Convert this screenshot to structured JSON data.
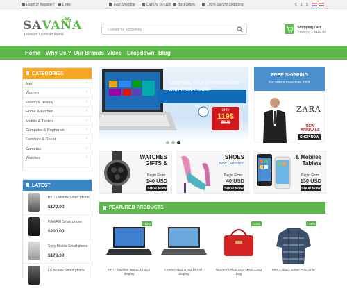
{
  "topbar": {
    "login": "Login",
    "or": "or",
    "register": "Register?",
    "links": "Links",
    "fast_shipping": "Fast Shipping",
    "call_us": "Call Us: 001125",
    "best_offers": "Best Offers",
    "secure_shopping": "100% Secure Shopping",
    "currencies": [
      "€",
      "£",
      "$"
    ]
  },
  "logo": {
    "name_part1": "SA",
    "name_part2": "VANA",
    "tagline": "premium Opencart theme"
  },
  "search": {
    "placeholder": "Looking for something ?"
  },
  "cart": {
    "title": "Shopping Cart",
    "summary": "3 item(s) - $445.00"
  },
  "nav": [
    "Home",
    "Why Us ?",
    "Our Brands",
    "Video",
    "Dropdown",
    "Blog"
  ],
  "categories": {
    "title": "CATEGORIES",
    "items": [
      "Men",
      "Women",
      "Health & Beauty",
      "Home & Kitchen",
      "Mobile & Tablets",
      "Computer & Prigherals",
      "Furniture & Decor",
      "Cameras",
      "Watches"
    ]
  },
  "latest": {
    "title": "LATEST",
    "items": [
      {
        "name": "HTCS Mobile Smart phone",
        "price": "$170.00"
      },
      {
        "name": "HAWAW Smart phone",
        "price": "$200.00"
      },
      {
        "name": "Sony Mobile Smart phone",
        "price": "$170.00"
      },
      {
        "name": "LG Mobile Smart phone",
        "price": ""
      }
    ]
  },
  "hero": {
    "headline": "Upgrade your performance with Intel Inside",
    "only_label": "only",
    "price": "119$",
    "old_price": "$50$"
  },
  "shipping": {
    "title": "FREE SHIPPING",
    "subtitle": "For orders more than 500$"
  },
  "zara": {
    "brand": "ZARA",
    "new_label": "NEW",
    "arrivals": "ARRIVALS",
    "shop": "SHOP NOW"
  },
  "promos": [
    {
      "title_line1": "WATCHES",
      "title_line2": "GIFTS &",
      "subtitle": "",
      "from": "Begin From",
      "price": "140 USD",
      "shop": "SHOP NOW"
    },
    {
      "title_line1": "SHOES",
      "title_line2": "",
      "subtitle": "New Collection",
      "from": "Begin From",
      "price": "40 USD",
      "shop": "SHOP NOW"
    },
    {
      "title_line1": "& Mobiles",
      "title_line2": "Tablets",
      "subtitle": "",
      "from": "Begin From",
      "price": "130 USD",
      "shop": "SHOP NOW"
    }
  ],
  "featured": {
    "title": "FEATURED PRODUCTS",
    "products": [
      {
        "name": "HP i7 Pavilion laptop 15 inch display",
        "badge": "-10%"
      },
      {
        "name": "Lenovo Idea S70g 15 inch display",
        "badge": ""
      },
      {
        "name": "Women's Plus Size Mesh Long Bag",
        "badge": "-15%"
      },
      {
        "name": "Men's Black Stripe Polo Shirt",
        "badge": "-18%"
      }
    ]
  },
  "colors": {
    "green": "#5cb84a",
    "blue": "#3a87c8",
    "orange": "#f5a623",
    "red": "#d0191f"
  }
}
